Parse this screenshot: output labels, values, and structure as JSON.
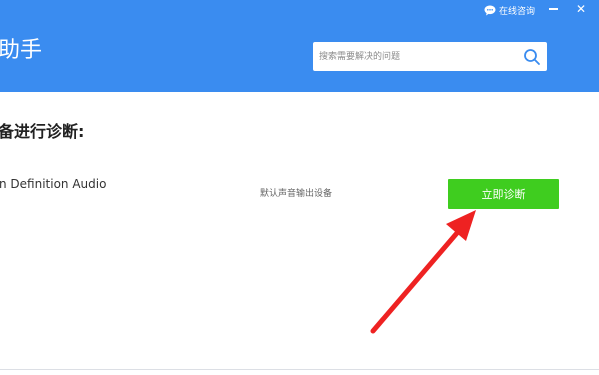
{
  "header": {
    "online_consult_label": "在线咨询",
    "app_title": "助手",
    "search": {
      "placeholder": "搜索需要解决的问题"
    },
    "icons": [
      "chat-bubble-icon",
      "minimize-icon",
      "close-icon",
      "search-icon"
    ]
  },
  "main": {
    "section_heading": "备进行诊断:",
    "device": {
      "name": "n Definition Audio",
      "type_label": "默认声音输出设备",
      "diagnose_button_label": "立即诊断"
    }
  },
  "annotation": {
    "color": "#ee2222"
  },
  "colors": {
    "header_bg": "#3a8cf0",
    "button_bg": "#3fcd1f"
  }
}
